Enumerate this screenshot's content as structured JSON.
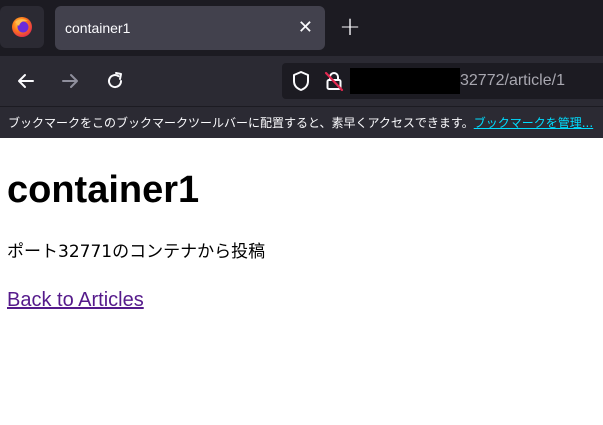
{
  "browser": {
    "tab": {
      "title": "container1"
    },
    "address": {
      "visible_text": "32772/article/1"
    },
    "bookmark_bar": {
      "message": "ブックマークをこのブックマークツールバーに配置すると、素早くアクセスできます。",
      "link_label": "ブックマークを管理..."
    },
    "icons": [
      "firefox-icon",
      "close-icon",
      "plus-icon",
      "back-arrow-icon",
      "forward-arrow-icon",
      "reload-icon",
      "shield-icon",
      "lock-icon"
    ]
  },
  "page": {
    "heading": "container1",
    "body": "ポート32771のコンテナから投稿",
    "back_link": "Back to Articles"
  },
  "colors": {
    "tabbar": "#1c1b22",
    "toolbar": "#2b2a33",
    "active_tab": "#42414d",
    "bookmark_link": "#00ddff",
    "visited_link": "#551a8b"
  }
}
